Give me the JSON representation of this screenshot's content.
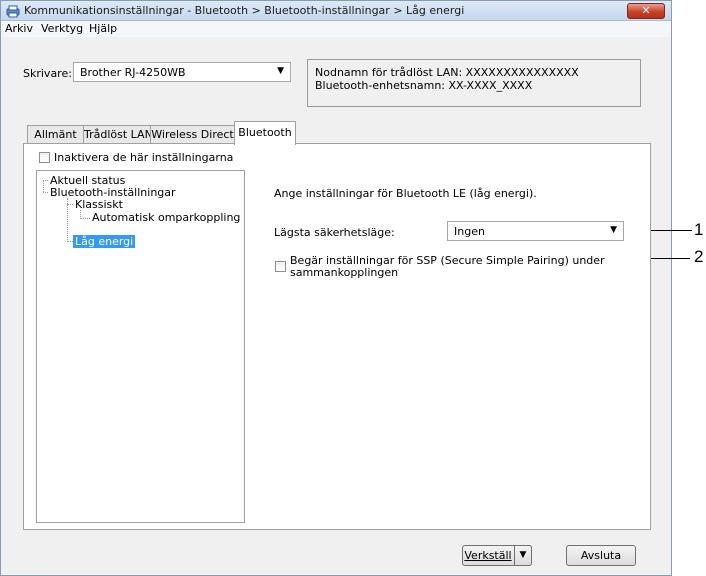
{
  "window": {
    "title": "Kommunikationsinställningar - Bluetooth > Bluetooth-inställningar > Låg energi",
    "close_label": "✕"
  },
  "menu": [
    "Arkiv",
    "Verktyg",
    "Hjälp"
  ],
  "printer": {
    "label": "Skrivare:",
    "value": "Brother RJ-4250WB",
    "info_line1": "Nodnamn för trådlöst LAN: XXXXXXXXXXXXXXX",
    "info_line2": "Bluetooth-enhetsnamn: XX-XXXX_XXXX"
  },
  "tabs": [
    "Allmänt",
    "Trådlöst LAN",
    "Wireless Direct",
    "Bluetooth"
  ],
  "active_tab": "Bluetooth",
  "disable_settings_label": "Inaktivera de här inställningarna",
  "tree": {
    "items": [
      "Aktuell status",
      "Bluetooth-inställningar",
      "Klassiskt",
      "Automatisk omparkoppling",
      "Låg energi"
    ],
    "selected": "Låg energi"
  },
  "content": {
    "heading": "Ange inställningar för Bluetooth LE (låg energi).",
    "security_label": "Lägsta säkerhetsläge:",
    "security_value": "Ingen",
    "ssp_label_line1": "Begär inställningar för SSP (Secure Simple Pairing) under",
    "ssp_label_line2": "sammankopplingen"
  },
  "buttons": {
    "apply": "Verkställ",
    "close": "Avsluta"
  },
  "callouts": [
    "1",
    "2"
  ]
}
